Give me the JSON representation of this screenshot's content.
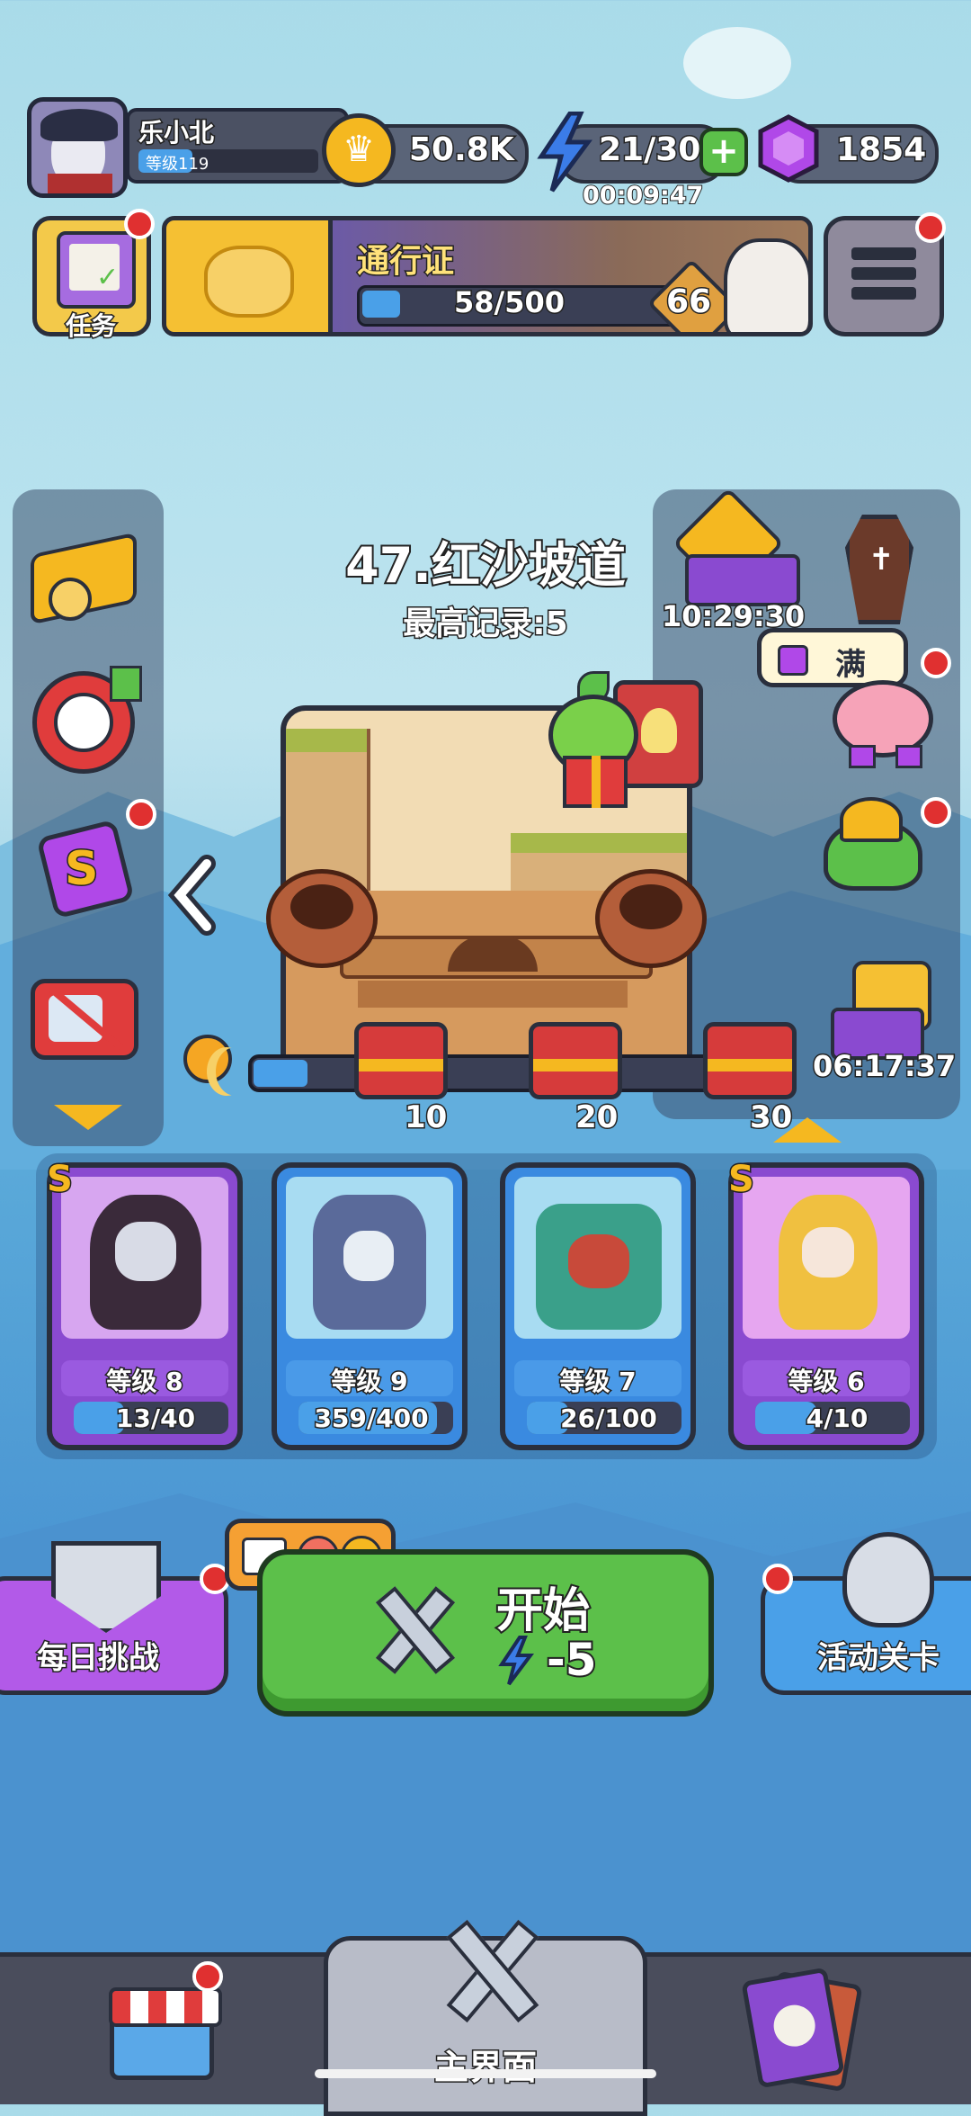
{
  "player": {
    "name": "乐小北",
    "level_label": "等级119"
  },
  "currency": {
    "coins": "50.8K",
    "energy": "21/30",
    "energy_timer": "00:09:47",
    "gems": "1854"
  },
  "tasks": {
    "label": "任务"
  },
  "pass": {
    "title": "通行证",
    "progress": "58/500",
    "progress_fraction": 0.116,
    "level": "66"
  },
  "stage": {
    "name": "47.红沙坡道",
    "best_record": "最高记录:5"
  },
  "right_timers": {
    "top": "10:29:30",
    "bottom": "06:17:37"
  },
  "piggy": {
    "status": "满"
  },
  "chests": [
    {
      "label": "10"
    },
    {
      "label": "20"
    },
    {
      "label": "30"
    }
  ],
  "heroes": [
    {
      "level": "等级 8",
      "progress": "13/40",
      "fraction": 0.325,
      "rank": "S",
      "theme": "purple"
    },
    {
      "level": "等级 9",
      "progress": "359/400",
      "fraction": 0.8975,
      "rank": "",
      "theme": "blue"
    },
    {
      "level": "等级 7",
      "progress": "26/100",
      "fraction": 0.26,
      "rank": "",
      "theme": "blue"
    },
    {
      "level": "等级 6",
      "progress": "4/10",
      "fraction": 0.4,
      "rank": "S",
      "theme": "purple"
    }
  ],
  "actions": {
    "daily_challenge": "每日挑战",
    "start": "开始",
    "start_cost": "-5",
    "event_stage": "活动关卡"
  },
  "bottom_nav": {
    "main": "主界面"
  },
  "colors": {
    "accent_green": "#5cc04a",
    "gem_purple": "#b048e8",
    "coin_gold": "#f5b820"
  }
}
